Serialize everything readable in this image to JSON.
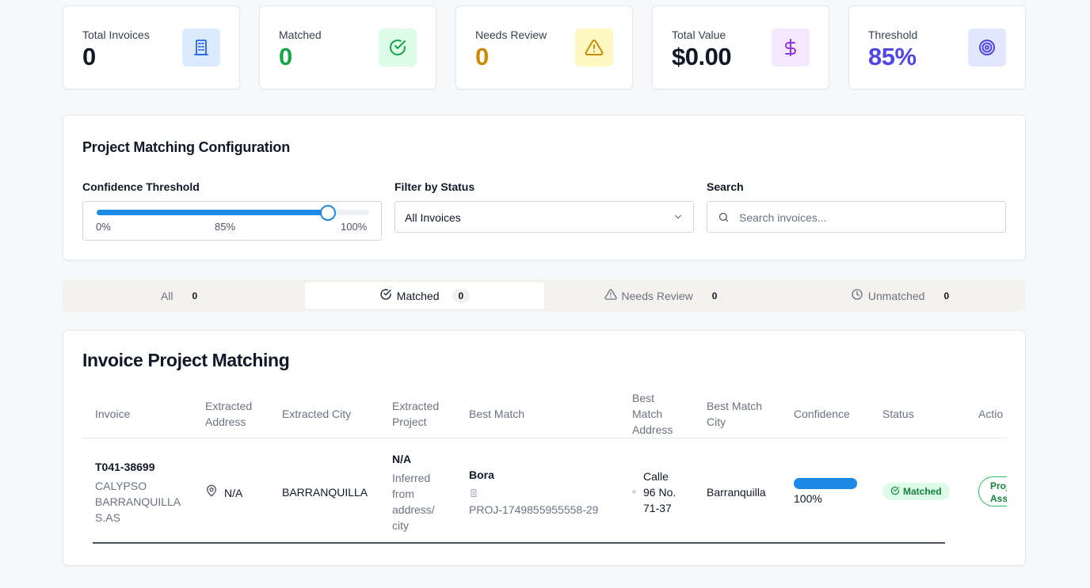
{
  "stats": [
    {
      "label": "Total Invoices",
      "value": "0",
      "color": "#111827",
      "icon": "building-icon",
      "icon_bg": "#dbeafe",
      "icon_color": "#2563eb"
    },
    {
      "label": "Matched",
      "value": "0",
      "color": "#16a34a",
      "icon": "check-circle-icon",
      "icon_bg": "#dcfce7",
      "icon_color": "#16a34a"
    },
    {
      "label": "Needs Review",
      "value": "0",
      "color": "#ca8a04",
      "icon": "warning-icon",
      "icon_bg": "#fef9c3",
      "icon_color": "#ca8a04"
    },
    {
      "label": "Total Value",
      "value": "$0.00",
      "color": "#111827",
      "icon": "dollar-icon",
      "icon_bg": "#f3e8ff",
      "icon_color": "#9333ea"
    },
    {
      "label": "Threshold",
      "value": "85%",
      "color": "#4f46e5",
      "icon": "target-icon",
      "icon_bg": "#e0e7ff",
      "icon_color": "#4f46e5"
    }
  ],
  "config": {
    "title": "Project Matching Configuration",
    "threshold_label": "Confidence Threshold",
    "threshold_value": 0.85,
    "tick_min": "0%",
    "tick_mid": "85%",
    "tick_max": "100%",
    "status_label": "Filter by Status",
    "status_value": "All Invoices",
    "search_label": "Search",
    "search_placeholder": "Search invoices..."
  },
  "tabs": [
    {
      "label": "All",
      "count": "0",
      "icon": ""
    },
    {
      "label": "Matched",
      "count": "0",
      "icon": "check-circle-icon",
      "active": true
    },
    {
      "label": "Needs Review",
      "count": "0",
      "icon": "warning-icon"
    },
    {
      "label": "Unmatched",
      "count": "0",
      "icon": "clock-icon"
    }
  ],
  "table": {
    "title": "Invoice Project Matching",
    "headers": {
      "invoice": "Invoice",
      "extracted_address_1": "Extracted",
      "extracted_address_2": "Address",
      "extracted_city": "Extracted City",
      "extracted_project_1": "Extracted",
      "extracted_project_2": "Project",
      "best_match": "Best Match",
      "best_match_address_1": "Best",
      "best_match_address_2": "Match",
      "best_match_address_3": "Address",
      "best_match_city_1": "Best Match",
      "best_match_city_2": "City",
      "confidence": "Confidence",
      "status": "Status",
      "actions": "Actio"
    },
    "row": {
      "invoice_id": "T041-38699",
      "vendor_1": "CALYPSO",
      "vendor_2": "BARRANQUILLA",
      "vendor_3": "S.AS",
      "extracted_address": "N/A",
      "extracted_city": "BARRANQUILLA",
      "extracted_project": "N/A",
      "project_note_1": "Inferred",
      "project_note_2": "from",
      "project_note_3": "address/",
      "project_note_4": "city",
      "best_match_name": "Bora",
      "best_match_code": "PROJ-1749855955558-29",
      "best_match_address_1": "Calle",
      "best_match_address_2": "96 No.",
      "best_match_address_3": "71-37",
      "best_match_city": "Barranquilla",
      "confidence": 1.0,
      "confidence_label": "100%",
      "status": "Matched",
      "action_1": "Proj",
      "action_2": "Assi"
    }
  }
}
